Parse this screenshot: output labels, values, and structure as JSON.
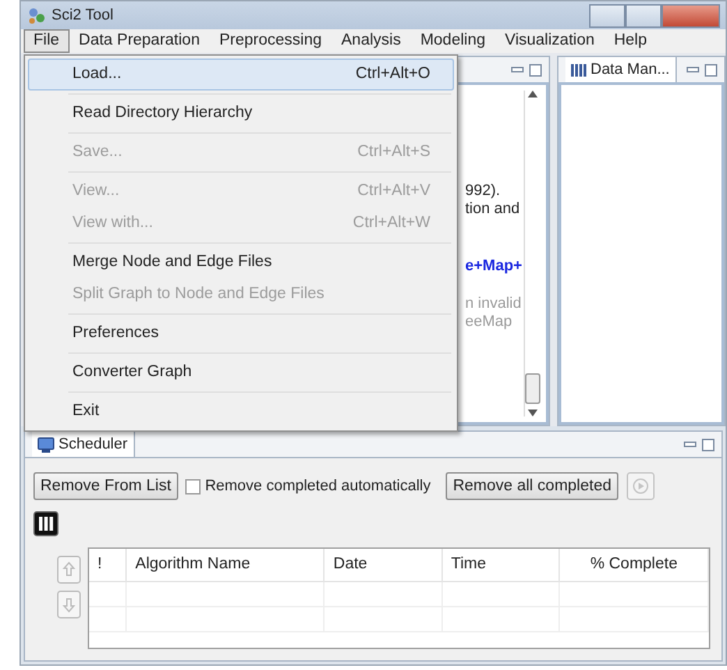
{
  "window": {
    "title": "Sci2 Tool"
  },
  "menu_bar": [
    {
      "label": "File",
      "selected": true
    },
    {
      "label": "Data Preparation",
      "selected": false
    },
    {
      "label": "Preprocessing",
      "selected": false
    },
    {
      "label": "Analysis",
      "selected": false
    },
    {
      "label": "Modeling",
      "selected": false
    },
    {
      "label": "Visualization",
      "selected": false
    },
    {
      "label": "Help",
      "selected": false
    }
  ],
  "file_menu": {
    "groups": [
      [
        {
          "label": "Load...",
          "shortcut": "Ctrl+Alt+O",
          "disabled": false,
          "selected": true
        }
      ],
      [
        {
          "label": "Read Directory Hierarchy",
          "disabled": false,
          "selected": false
        }
      ],
      [
        {
          "label": "Save...",
          "shortcut": "Ctrl+Alt+S",
          "disabled": true,
          "selected": false
        }
      ],
      [
        {
          "label": "View...",
          "shortcut": "Ctrl+Alt+V",
          "disabled": true,
          "selected": false
        },
        {
          "label": "View with...",
          "shortcut": "Ctrl+Alt+W",
          "disabled": true,
          "selected": false
        }
      ],
      [
        {
          "label": "Merge Node and Edge Files",
          "disabled": false,
          "selected": false
        },
        {
          "label": "Split Graph to Node and Edge Files",
          "disabled": true,
          "selected": false
        }
      ],
      [
        {
          "label": "Preferences",
          "disabled": false,
          "selected": false
        }
      ],
      [
        {
          "label": "Converter Graph",
          "disabled": false,
          "selected": false
        }
      ],
      [
        {
          "label": "Exit",
          "disabled": false,
          "selected": false
        }
      ]
    ]
  },
  "console_panel": {
    "lines": [
      {
        "text": "992).",
        "kind": "plain"
      },
      {
        "text": "tion and",
        "kind": "plain"
      },
      {
        "text": "e+Map+",
        "kind": "link"
      },
      {
        "text": "n invalid",
        "kind": "dim"
      },
      {
        "text": "eeMap",
        "kind": "dim"
      }
    ]
  },
  "data_manager": {
    "tab": "Data Man..."
  },
  "scheduler": {
    "tab": "Scheduler",
    "remove_button": "Remove From List",
    "auto_remove": {
      "label": "Remove completed automatically",
      "checked": false
    },
    "remove_all_button": "Remove all completed",
    "columns": [
      "!",
      "Algorithm Name",
      "Date",
      "Time",
      "% Complete"
    ]
  }
}
